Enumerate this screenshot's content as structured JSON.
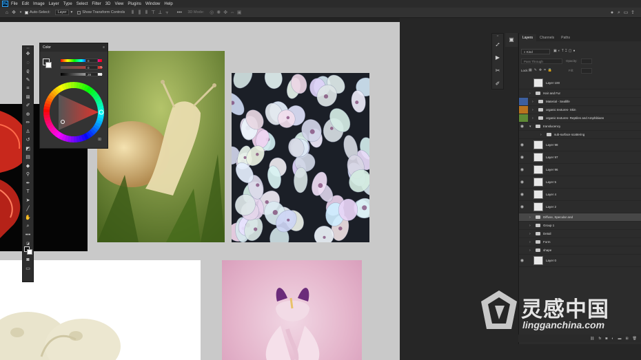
{
  "app": {
    "name": "Photoshop",
    "logo": "Ps"
  },
  "menu": [
    "File",
    "Edit",
    "Image",
    "Layer",
    "Type",
    "Select",
    "Filter",
    "3D",
    "View",
    "Plugins",
    "Window",
    "Help"
  ],
  "options": {
    "auto_select_label": "Auto-Select:",
    "auto_select_value": "Layer",
    "transform_controls_label": "Show Transform Controls",
    "mode_3d_label": "3D Mode:"
  },
  "color_panel": {
    "title": "Color",
    "values": [
      "0",
      "0",
      "28"
    ],
    "units": [
      "",
      "%",
      "%"
    ],
    "accent": "#e0342c"
  },
  "layers_panel": {
    "tabs": [
      "Layers",
      "Channels",
      "Paths"
    ],
    "kind_label": "Kind",
    "blend_mode": "Pass Through",
    "opacity_label": "Opacity:",
    "lock_label": "Lock:",
    "fill_label": "Fill:",
    "layers": [
      {
        "name": "Layer 100",
        "type": "layer",
        "visible": false,
        "color": ""
      },
      {
        "name": "Hair and Fur",
        "type": "group",
        "visible": false,
        "color": ""
      },
      {
        "name": "Material - Seallife",
        "type": "group",
        "visible": false,
        "color": "#3d5f9e"
      },
      {
        "name": "organic textures- Skin",
        "type": "group",
        "visible": false,
        "color": "#b8731e"
      },
      {
        "name": "organic textures- Reptiles and Amphibians",
        "type": "group",
        "visible": false,
        "color": "#5e8a35"
      },
      {
        "name": "translucency",
        "type": "group-open",
        "visible": true,
        "color": ""
      },
      {
        "name": "sub-surface scattering",
        "type": "group",
        "visible": false,
        "color": ""
      },
      {
        "name": "Layer 98",
        "type": "layer",
        "visible": true,
        "color": ""
      },
      {
        "name": "Layer 97",
        "type": "layer",
        "visible": true,
        "color": ""
      },
      {
        "name": "Layer 96",
        "type": "layer",
        "visible": true,
        "color": ""
      },
      {
        "name": "Layer 5",
        "type": "layer",
        "visible": true,
        "color": ""
      },
      {
        "name": "Layer 4",
        "type": "layer",
        "visible": true,
        "color": ""
      },
      {
        "name": "Layer 2",
        "type": "layer",
        "visible": true,
        "color": ""
      },
      {
        "name": "Diffuse, Specular and",
        "type": "group",
        "visible": false,
        "color": "",
        "selected": true
      },
      {
        "name": "Group 1",
        "type": "group",
        "visible": false,
        "color": ""
      },
      {
        "name": "Detail",
        "type": "group",
        "visible": false,
        "color": ""
      },
      {
        "name": "Form",
        "type": "group",
        "visible": false,
        "color": ""
      },
      {
        "name": "shape",
        "type": "group",
        "visible": false,
        "color": ""
      },
      {
        "name": "Layer 0",
        "type": "layer",
        "visible": true,
        "color": ""
      }
    ]
  },
  "watermark": {
    "cn": "灵感中国",
    "url": "lingganchina.com"
  }
}
